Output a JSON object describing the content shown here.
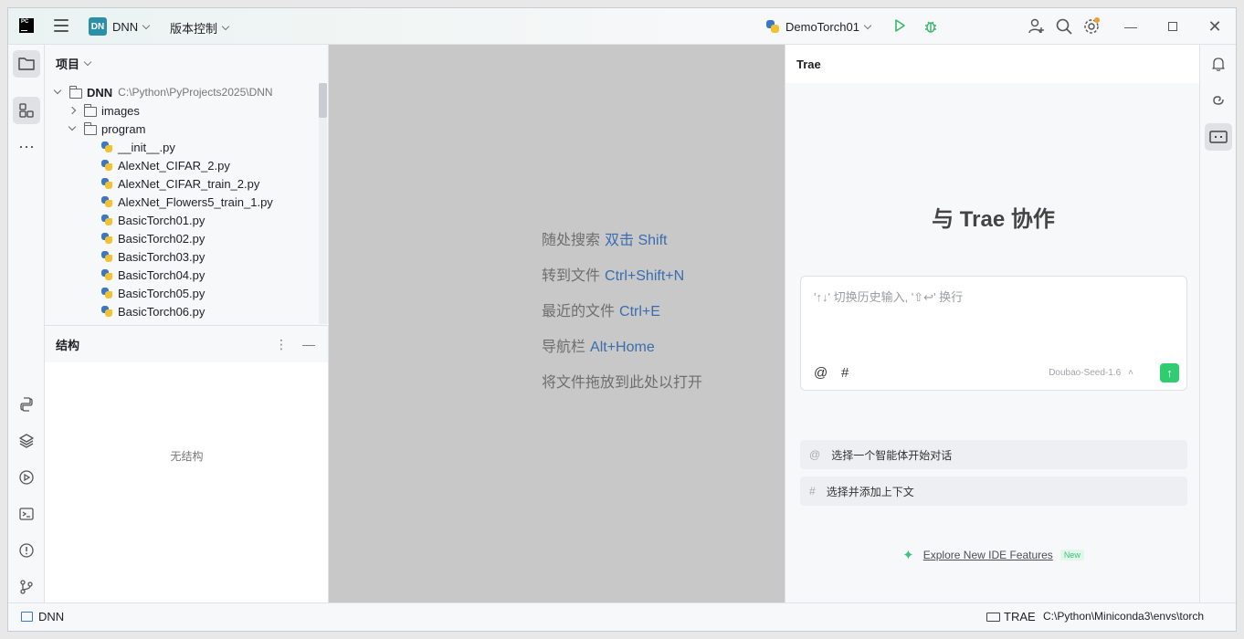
{
  "titlebar": {
    "app_logo_text": "PC",
    "project_badge": "DN",
    "project_name": "DNN",
    "vcs_label": "版本控制",
    "run_config": "DemoTorch01"
  },
  "project_panel": {
    "title": "项目",
    "root_name": "DNN",
    "root_path": "C:\\Python\\PyProjects2025\\DNN",
    "items": [
      {
        "label": "images",
        "kind": "folder"
      },
      {
        "label": "program",
        "kind": "folder"
      },
      {
        "label": "__init__.py",
        "kind": "py"
      },
      {
        "label": "AlexNet_CIFAR_2.py",
        "kind": "py"
      },
      {
        "label": "AlexNet_CIFAR_train_2.py",
        "kind": "py"
      },
      {
        "label": "AlexNet_Flowers5_train_1.py",
        "kind": "py"
      },
      {
        "label": "BasicTorch01.py",
        "kind": "py"
      },
      {
        "label": "BasicTorch02.py",
        "kind": "py"
      },
      {
        "label": "BasicTorch03.py",
        "kind": "py"
      },
      {
        "label": "BasicTorch04.py",
        "kind": "py"
      },
      {
        "label": "BasicTorch05.py",
        "kind": "py"
      },
      {
        "label": "BasicTorch06.py",
        "kind": "py"
      }
    ]
  },
  "structure_panel": {
    "title": "结构",
    "empty_text": "无结构"
  },
  "editor_hints": [
    {
      "text": "随处搜索",
      "key": "双击 Shift"
    },
    {
      "text": "转到文件",
      "key": "Ctrl+Shift+N"
    },
    {
      "text": "最近的文件",
      "key": "Ctrl+E"
    },
    {
      "text": "导航栏",
      "key": "Alt+Home"
    },
    {
      "text": "将文件拖放到此处以打开",
      "key": ""
    }
  ],
  "trae": {
    "header": "Trae",
    "title": "与 Trae 协作",
    "placeholder": "'↑↓' 切换历史输入, '⇧↩' 换行",
    "at_symbol": "@",
    "hash_symbol": "#",
    "model": "Doubao-Seed-1.6",
    "send_arrow": "↑",
    "action_agent": "选择一个智能体开始对话",
    "action_context": "选择并添加上下文",
    "explore_link": "Explore New IDE Features",
    "new_badge": "New"
  },
  "statusbar": {
    "project": "DNN",
    "trae_label": "TRAE",
    "interpreter_path": "C:\\Python\\Miniconda3\\envs\\torch"
  },
  "colors": {
    "accent_blue": "#3a6db0",
    "send_green": "#2fcc71",
    "project_badge": "#2a8fa8",
    "editor_bg": "#c8c8c8"
  }
}
